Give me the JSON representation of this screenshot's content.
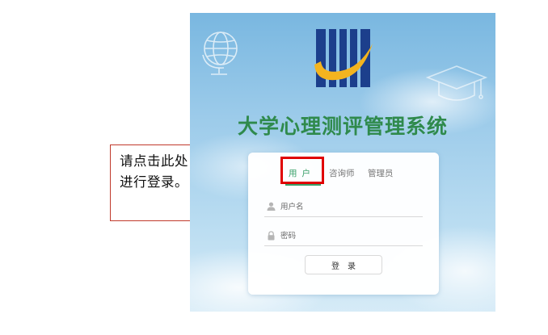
{
  "annotation": {
    "instruction": "请点击此处进行登录。"
  },
  "login_page": {
    "system_title": "大学心理测评管理系统",
    "tabs": [
      {
        "label": "用户",
        "active": true
      },
      {
        "label": "咨询师",
        "active": false
      },
      {
        "label": "管理员",
        "active": false
      }
    ],
    "username_placeholder": "用户名",
    "password_placeholder": "密码",
    "login_button": "登录"
  },
  "colors": {
    "accent_green": "#3aa06a",
    "title_green": "#2f8a4c",
    "highlight_red": "#e00000",
    "logo_blue": "#1c3f8c",
    "logo_gold": "#f3b41f"
  },
  "icons": [
    "globe-icon",
    "graduation-cap-icon",
    "user-icon",
    "lock-icon",
    "arrow-right-icon"
  ]
}
